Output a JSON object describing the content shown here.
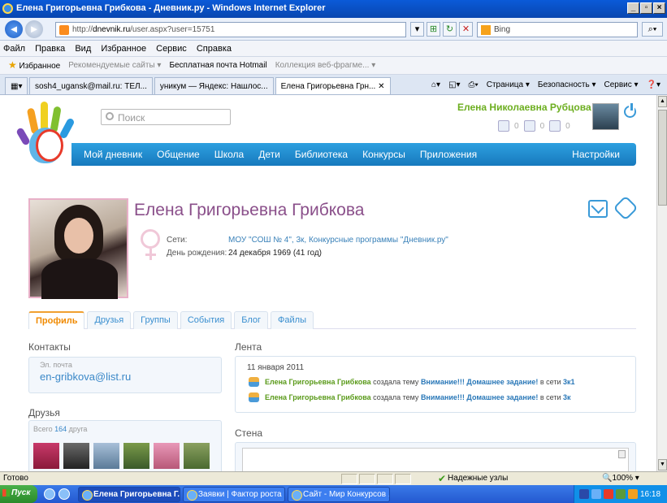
{
  "window": {
    "title": "Елена Григорьевна Грибкова - Дневник.ру - Windows Internet Explorer",
    "min": "_",
    "max": "▫",
    "close": "×"
  },
  "address": {
    "domain": "dnevnik.ru",
    "url_path": "/user.aspx?user=15751",
    "url_prefix": "http://",
    "search_placeholder": "Bing"
  },
  "menu": [
    "Файл",
    "Правка",
    "Вид",
    "Избранное",
    "Сервис",
    "Справка"
  ],
  "favorites_bar": {
    "favorites": "Избранное",
    "item1": "Рекомендуемые сайты ▾",
    "item2": "Бесплатная почта Hotmail",
    "item3": "Коллекция веб-фрагме... ▾"
  },
  "browser_tabs": [
    "sosh4_ugansk@mail.ru: ТЕЛ...",
    "уникум — Яндекс: Нашлос...",
    "Елена Григорьевна Грн... ✕"
  ],
  "command_bar": [
    "Страница ▾",
    "Безопасность ▾",
    "Сервис ▾"
  ],
  "site": {
    "search_placeholder": "Поиск",
    "current_user": "Елена Николаевна Рубцова",
    "counters": [
      "0",
      "0",
      "0"
    ],
    "nav": [
      "Мой дневник",
      "Общение",
      "Школа",
      "Дети",
      "Библиотека",
      "Конкурсы",
      "Приложения"
    ],
    "settings": "Настройки"
  },
  "profile": {
    "name": "Елена Григорьевна Грибкова",
    "networks_label": "Сети:",
    "networks_value": "МОУ \"СОШ № 4\", 3к, Конкурсные программы \"Дневник.ру\"",
    "birthday_label": "День рождения:",
    "birthday_value": "24 декабря 1969 (41 год)",
    "tabs": [
      "Профиль",
      "Друзья",
      "Группы",
      "События",
      "Блог",
      "Файлы"
    ]
  },
  "contacts": {
    "heading": "Контакты",
    "email_label": "Эл. почта",
    "email": "en-gribkova@list.ru"
  },
  "friends": {
    "heading": "Друзья",
    "total_prefix": "Всего",
    "total_count": "164",
    "total_suffix": "друга"
  },
  "feed": {
    "heading": "Лента",
    "date": "11 января 2011",
    "items": [
      {
        "user": "Елена Григорьевна Грибкова",
        "action": "создала тему",
        "topic": "Внимание!!! Домашнее задание!",
        "in": "в сети",
        "network": "3к1"
      },
      {
        "user": "Елена Григорьевна Грибкова",
        "action": "создала тему",
        "topic": "Внимание!!! Домашнее задание!",
        "in": "в сети",
        "network": "3к"
      }
    ]
  },
  "wall": {
    "heading": "Стена"
  },
  "status": {
    "text": "Готово",
    "zone": "Надежные узлы",
    "zoom": "🔍100% ▾"
  },
  "taskbar": {
    "start": "Пуск",
    "buttons": [
      "Елена Григорьевна Г...",
      "Заявки | Фактор роста ...",
      "Сайт - Мир Конкурсов ..."
    ],
    "clock": "16:18"
  }
}
